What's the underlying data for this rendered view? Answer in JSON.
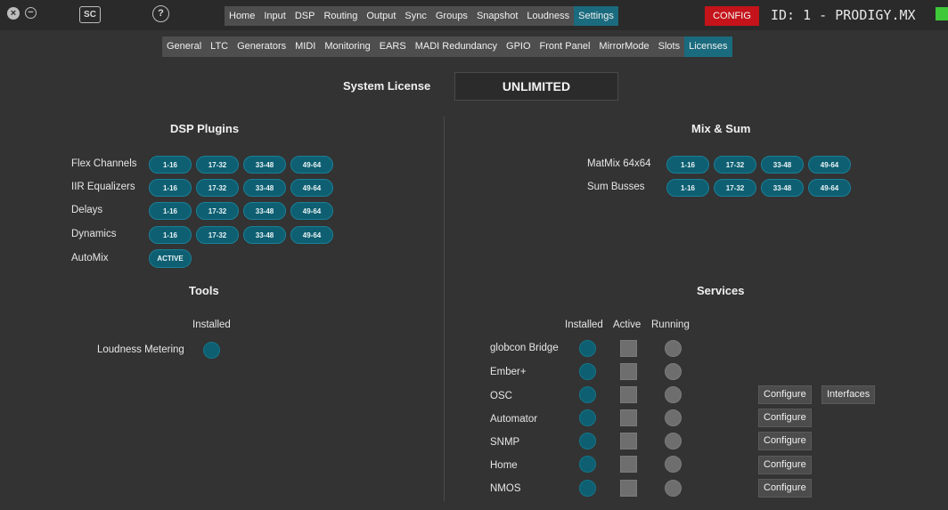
{
  "titlebar": {
    "sc_badge": "SC",
    "help_symbol": "?",
    "close_symbol": "×",
    "minimize_symbol": "−"
  },
  "main_nav": {
    "tabs": [
      "Home",
      "Input",
      "DSP",
      "Routing",
      "Output",
      "Sync",
      "Groups",
      "Snapshot",
      "Loudness",
      "Settings"
    ],
    "active": "Settings"
  },
  "config_button": "CONFIG",
  "device_id": "ID: 1 - PRODIGY.MX",
  "status_led_color": "#3ec83a",
  "sub_nav": {
    "tabs": [
      "General",
      "LTC",
      "Generators",
      "MIDI",
      "Monitoring",
      "EARS",
      "MADI Redundancy",
      "GPIO",
      "Front Panel",
      "MirrorMode",
      "Slots",
      "Licenses"
    ],
    "active": "Licenses"
  },
  "system_license": {
    "label": "System License",
    "value": "UNLIMITED"
  },
  "dsp_plugins": {
    "title": "DSP Plugins",
    "rows": [
      {
        "label": "Flex Channels",
        "buttons": [
          "1-16",
          "17-32",
          "33-48",
          "49-64"
        ]
      },
      {
        "label": "IIR Equalizers",
        "buttons": [
          "1-16",
          "17-32",
          "33-48",
          "49-64"
        ]
      },
      {
        "label": "Delays",
        "buttons": [
          "1-16",
          "17-32",
          "33-48",
          "49-64"
        ]
      },
      {
        "label": "Dynamics",
        "buttons": [
          "1-16",
          "17-32",
          "33-48",
          "49-64"
        ]
      },
      {
        "label": "AutoMix",
        "buttons": [
          "ACTIVE"
        ]
      }
    ]
  },
  "mix_sum": {
    "title": "Mix & Sum",
    "rows": [
      {
        "label": "MatMix 64x64",
        "buttons": [
          "1-16",
          "17-32",
          "33-48",
          "49-64"
        ]
      },
      {
        "label": "Sum Busses",
        "buttons": [
          "1-16",
          "17-32",
          "33-48",
          "49-64"
        ]
      }
    ]
  },
  "tools": {
    "title": "Tools",
    "column_installed": "Installed",
    "items": [
      {
        "label": "Loudness Metering",
        "installed": true
      }
    ]
  },
  "services": {
    "title": "Services",
    "columns": {
      "installed": "Installed",
      "active": "Active",
      "running": "Running"
    },
    "items": [
      {
        "label": "globcon Bridge",
        "installed": true,
        "active": false,
        "running": false,
        "buttons": []
      },
      {
        "label": "Ember+",
        "installed": true,
        "active": false,
        "running": false,
        "buttons": []
      },
      {
        "label": "OSC",
        "installed": true,
        "active": false,
        "running": false,
        "buttons": [
          "Configure",
          "Interfaces"
        ]
      },
      {
        "label": "Automator",
        "installed": true,
        "active": false,
        "running": false,
        "buttons": [
          "Configure"
        ]
      },
      {
        "label": "SNMP",
        "installed": true,
        "active": false,
        "running": false,
        "buttons": [
          "Configure"
        ]
      },
      {
        "label": "Home",
        "installed": true,
        "active": false,
        "running": false,
        "buttons": [
          "Configure"
        ]
      },
      {
        "label": "NMOS",
        "installed": true,
        "active": false,
        "running": false,
        "buttons": [
          "Configure"
        ]
      }
    ]
  },
  "colors": {
    "accent": "#1a6b7e",
    "pill": "#0f5f72",
    "config": "#c4131a",
    "background": "#333333"
  }
}
